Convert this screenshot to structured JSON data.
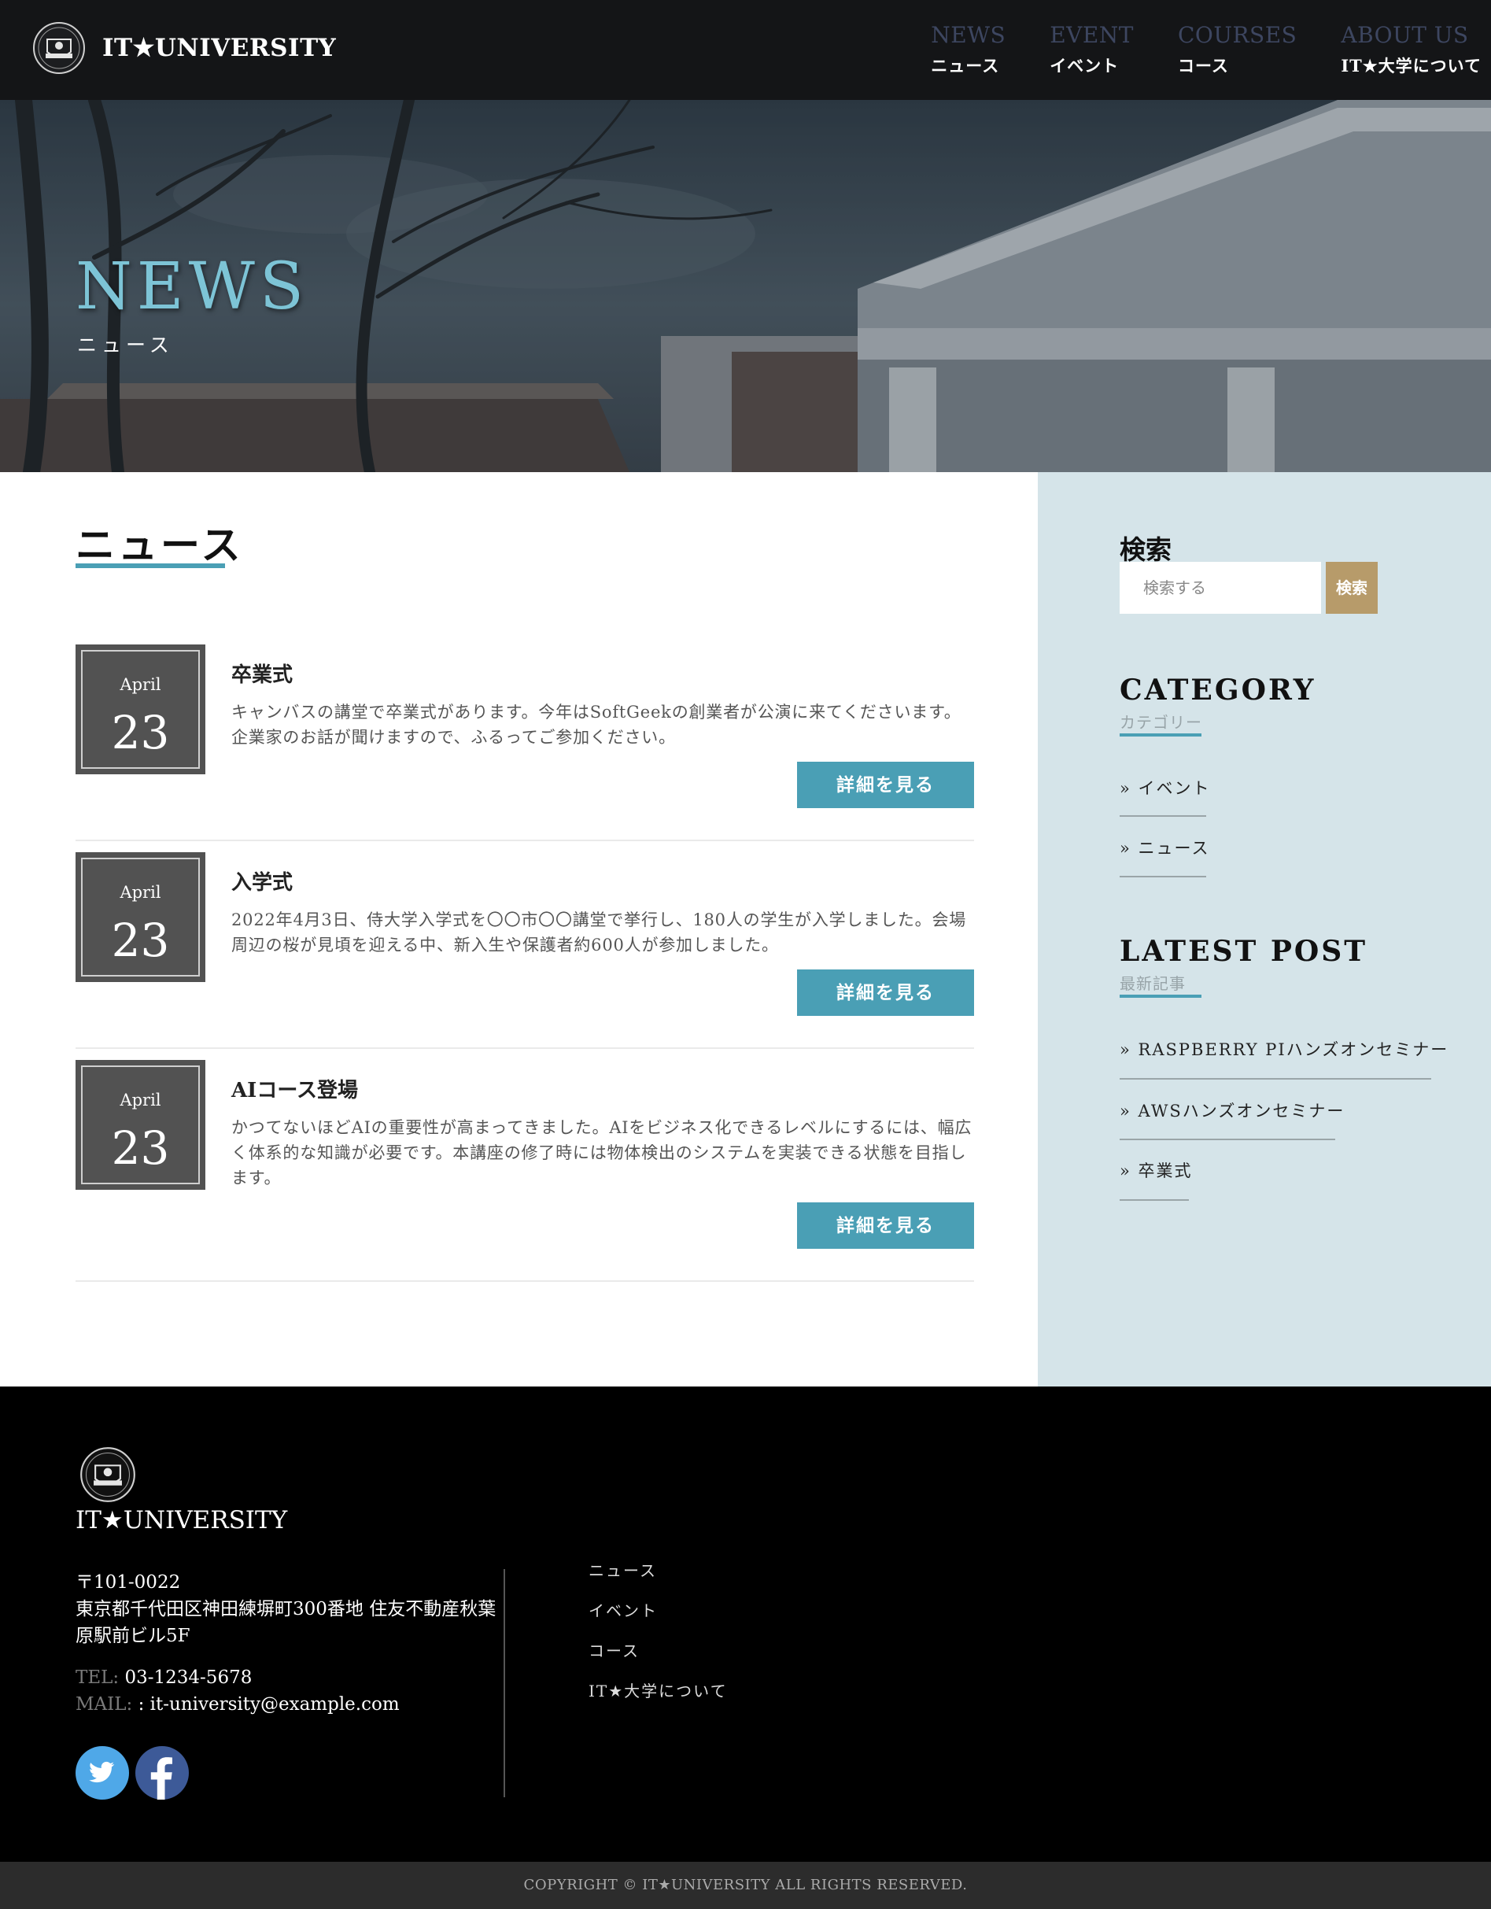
{
  "header": {
    "logo_text": "IT★UNIVERSITY",
    "nav": [
      {
        "en": "NEWS",
        "ja": "ニュース"
      },
      {
        "en": "EVENT",
        "ja": "イベント"
      },
      {
        "en": "COURSES",
        "ja": "コース"
      },
      {
        "en": "ABOUT US",
        "ja": "IT★大学について"
      }
    ]
  },
  "hero": {
    "title": "NEWS",
    "subtitle": "ニュース"
  },
  "main": {
    "page_title": "ニュース",
    "posts": [
      {
        "month": "April",
        "day": "23",
        "title": "卒業式",
        "excerpt": "キャンバスの講堂で卒業式があります。今年はSoftGeekの創業者が公演に来てくださいます。企業家のお話が聞けますので、ふるってご参加ください。",
        "button": "詳細を見る"
      },
      {
        "month": "April",
        "day": "23",
        "title": "入学式",
        "excerpt": "2022年4月3日、侍大学入学式を〇〇市〇〇講堂で挙行し、180人の学生が入学しました。会場周辺の桜が見頃を迎える中、新入生や保護者約600人が参加しました。",
        "button": "詳細を見る"
      },
      {
        "month": "April",
        "day": "23",
        "title": "AIコース登場",
        "excerpt": "かつてないほどAIの重要性が高まってきました。AIをビジネス化できるレベルにするには、幅広く体系的な知識が必要です。本講座の修了時には物体検出のシステムを実装できる状態を目指します。",
        "button": "詳細を見る"
      }
    ]
  },
  "sidebar": {
    "search_title": "検索",
    "search_placeholder": "検索する",
    "search_button": "検索",
    "category_heading": "CATEGORY",
    "category_sub": "カテゴリー",
    "categories": [
      "» イベント",
      "» ニュース"
    ],
    "latest_heading": "LATEST POST",
    "latest_sub": "最新記事",
    "latest_posts": [
      "» RASPBERRY PIハンズオンセミナー",
      "» AWSハンズオンセミナー",
      "» 卒業式"
    ]
  },
  "footer": {
    "name": "IT★UNIVERSITY",
    "postal": "〒101-0022",
    "address": "東京都千代田区神田練塀町300番地 住友不動産秋葉原駅前ビル5F",
    "tel_label": "TEL:",
    "tel": "03-1234-5678",
    "mail_label": "MAIL:",
    "mail": ": it-university@example.com",
    "links": [
      "ニュース",
      "イベント",
      "コース",
      "IT★大学について"
    ],
    "copyright": "COPYRIGHT © IT★UNIVERSITY ALL RIGHTS RESERVED."
  },
  "colors": {
    "accent": "#4a9fb5",
    "sidebar_bg": "#d5e4e9",
    "search_button": "#b79b6a",
    "twitter": "#4fa8e8",
    "facebook": "#3d5a98"
  },
  "icons": {
    "logo": "university-emblem-icon",
    "twitter": "twitter-icon",
    "facebook": "facebook-icon"
  }
}
